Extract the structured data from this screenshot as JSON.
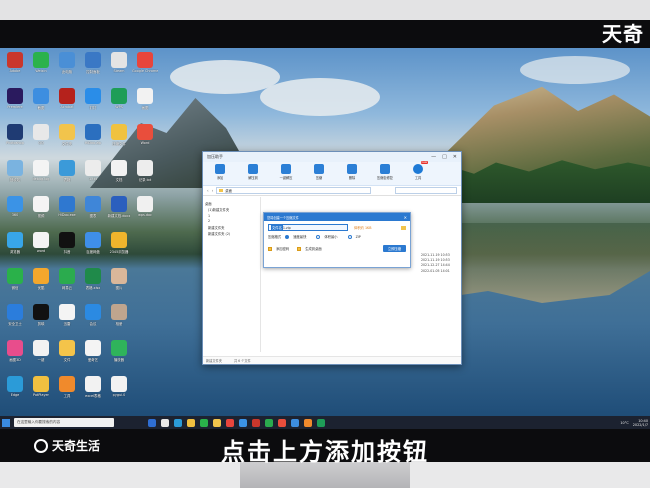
{
  "watermark": "天奇",
  "footer": {
    "brand": "天奇生活",
    "caption": "点击上方添加按钮"
  },
  "desktop_icons": [
    {
      "label": "Adobe",
      "color": "#c9372c"
    },
    {
      "label": "Weixin",
      "color": "#2bb24c"
    },
    {
      "label": "此电脑",
      "color": "#4a8fd6"
    },
    {
      "label": "控制面板",
      "color": "#3a78c5"
    },
    {
      "label": "Steam",
      "color": "#e4e4e4"
    },
    {
      "label": "Google Chrome",
      "color": "#e8453c"
    },
    {
      "label": "Premiere",
      "color": "#2a1a5e"
    },
    {
      "label": "截图",
      "color": "#3d8ee0"
    },
    {
      "label": "Acrobat",
      "color": "#b5221c"
    },
    {
      "label": "钉钉",
      "color": "#2a8de8"
    },
    {
      "label": "WPS",
      "color": "#1e9d57"
    },
    {
      "label": "画图",
      "color": "#f2f2f2"
    },
    {
      "label": "Photoshop",
      "color": "#1f3b73"
    },
    {
      "label": "QQ",
      "color": "#e8e8e8"
    },
    {
      "label": "文件夹",
      "color": "#f2c44c"
    },
    {
      "label": "HiDoo.zip",
      "color": "#2b6fbf"
    },
    {
      "label": "压缩文件",
      "color": "#f0c240"
    },
    {
      "label": "Word",
      "color": "#e94e3c"
    },
    {
      "label": "回收站",
      "color": "#7ab3e0"
    },
    {
      "label": "debug.log",
      "color": "#f4f4f4"
    },
    {
      "label": "表格",
      "color": "#3b9ad9"
    },
    {
      "label": "1.txt",
      "color": "#ececec"
    },
    {
      "label": "文档",
      "color": "#f2f2f2"
    },
    {
      "label": "记录.txt",
      "color": "#ededed"
    },
    {
      "label": "360",
      "color": "#3b93e6"
    },
    {
      "label": "视频",
      "color": "#f4f4f4"
    },
    {
      "label": "HiDoo.exe",
      "color": "#2f78d0"
    },
    {
      "label": "图表",
      "color": "#3f86d8"
    },
    {
      "label": "新建文档.docx",
      "color": "#2b5fbe"
    },
    {
      "label": "wps.doc",
      "color": "#f0f0f0"
    },
    {
      "label": "浏览器",
      "color": "#38a6e8"
    },
    {
      "label": "word",
      "color": "#f4f4f4"
    },
    {
      "label": "抖音",
      "color": "#111111"
    },
    {
      "label": "百度网盘",
      "color": "#3f8fe8"
    },
    {
      "label": "2345浏览器",
      "color": "#f0b52c"
    },
    {
      "label": "",
      "color": "#00000000"
    },
    {
      "label": "微信",
      "color": "#2ab14a"
    },
    {
      "label": "优酷",
      "color": "#f3a72c"
    },
    {
      "label": "网易云",
      "color": "#2bab4e"
    },
    {
      "label": "表格.xlsx",
      "color": "#1f8a4a"
    },
    {
      "label": "图片",
      "color": "#d9b79a"
    },
    {
      "label": "",
      "color": "#00000000"
    },
    {
      "label": "安全卫士",
      "color": "#2b7ddc"
    },
    {
      "label": "剪映",
      "color": "#111111"
    },
    {
      "label": "迅雷",
      "color": "#f4f4f4"
    },
    {
      "label": "会议",
      "color": "#2b8ae2"
    },
    {
      "label": "相册",
      "color": "#bfa58e"
    },
    {
      "label": "",
      "color": "#00000000"
    },
    {
      "label": "画图3D",
      "color": "#e84d8c"
    },
    {
      "label": "一键",
      "color": "#f2f2f2"
    },
    {
      "label": "文件",
      "color": "#f4c44a"
    },
    {
      "label": "爱奇艺",
      "color": "#f4f4f4"
    },
    {
      "label": "播放器",
      "color": "#2fb35b"
    },
    {
      "label": "",
      "color": "#00000000"
    },
    {
      "label": "Edge",
      "color": "#2b9bd8"
    },
    {
      "label": "PotPlayer",
      "color": "#f1c040"
    },
    {
      "label": "工具",
      "color": "#f08a2c"
    },
    {
      "label": "excel表格",
      "color": "#f2f2f2"
    },
    {
      "label": "pygui.0",
      "color": "#f2f2f2"
    },
    {
      "label": "",
      "color": "#00000000"
    }
  ],
  "window": {
    "title": "加压助手",
    "controls": [
      "—",
      "□",
      "✕"
    ],
    "toolbar": [
      {
        "label": "添加",
        "icon": "add-icon"
      },
      {
        "label": "解压到",
        "icon": "extract-icon"
      },
      {
        "label": "一键解压",
        "icon": "one-click-extract-icon"
      },
      {
        "label": "压缩",
        "icon": "compress-icon"
      },
      {
        "label": "删除",
        "icon": "delete-icon"
      },
      {
        "label": "压缩包修复",
        "icon": "repair-icon"
      },
      {
        "label": "工具",
        "icon": "tools-icon",
        "badge": "new"
      }
    ],
    "address": "桌面",
    "tree": [
      "桌面",
      "(1)新建文件夹",
      "1",
      "2",
      "新建文件夹",
      "新建文件夹 (2)"
    ],
    "dates": [
      "2021-11-19 10:53",
      "2021-11-19 10:53",
      "2021-12-27 14:44",
      "2022-01-05 14:01"
    ],
    "statusbar": [
      "新建文件夹",
      "共 6 个文件"
    ],
    "dialog": {
      "title": "您将创建一个压缩文件",
      "name_label": "文件名",
      "name_value": "1.zip",
      "size_label": "体积约 1KB",
      "format_label": "压缩格式",
      "option_fast": "速度最快",
      "option_small": "体积最小",
      "option_zip": "ZIP",
      "add_pwd": "添加密码",
      "gen_desktop": "生成到桌面",
      "ok": "立即压缩"
    }
  },
  "taskbar": {
    "search_placeholder": "在这里输入你要搜索的内容",
    "apps": [
      "#2f6ed2",
      "#e8e8e8",
      "#2b9bd8",
      "#f1c040",
      "#2ab14a",
      "#f2c44c",
      "#e8453c",
      "#3b93e6",
      "#c9372c",
      "#2bab4e",
      "#e94e3c",
      "#3d8ee0",
      "#f08a2c",
      "#1e9d57"
    ],
    "weather": "10°C",
    "time": "10:40",
    "date": "2022/1/7"
  }
}
